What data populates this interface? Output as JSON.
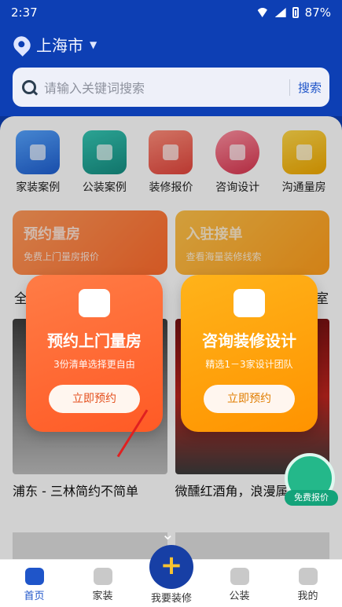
{
  "status": {
    "time": "2:37",
    "battery": "87%"
  },
  "header": {
    "city": "上海市",
    "search_placeholder": "请输入关键词搜索",
    "search_button": "搜索"
  },
  "categories": [
    {
      "label": "家装案例"
    },
    {
      "label": "公装案例"
    },
    {
      "label": "装修报价"
    },
    {
      "label": "咨询设计"
    },
    {
      "label": "沟通量房"
    }
  ],
  "banners": [
    {
      "title": "预约量房",
      "subtitle": "免费上门量房报价"
    },
    {
      "title": "入驻接单",
      "subtitle": "查看海量装修线索"
    }
  ],
  "tabs_row": {
    "left": "全",
    "right": "卧室"
  },
  "feed": [
    {
      "title": "浦东 - 三林简约不简单"
    },
    {
      "title": "微醺红酒角，浪漫属区"
    }
  ],
  "popups": [
    {
      "title": "预约上门量房",
      "subtitle": "3份清单选择更自由",
      "button": "立即预约"
    },
    {
      "title": "咨询装修设计",
      "subtitle": "精选1－3家设计团队",
      "button": "立即预约"
    }
  ],
  "float": {
    "label": "免费报价"
  },
  "tabbar": [
    {
      "label": "首页"
    },
    {
      "label": "家装"
    },
    {
      "label": "我要装修"
    },
    {
      "label": "公装"
    },
    {
      "label": "我的"
    }
  ]
}
